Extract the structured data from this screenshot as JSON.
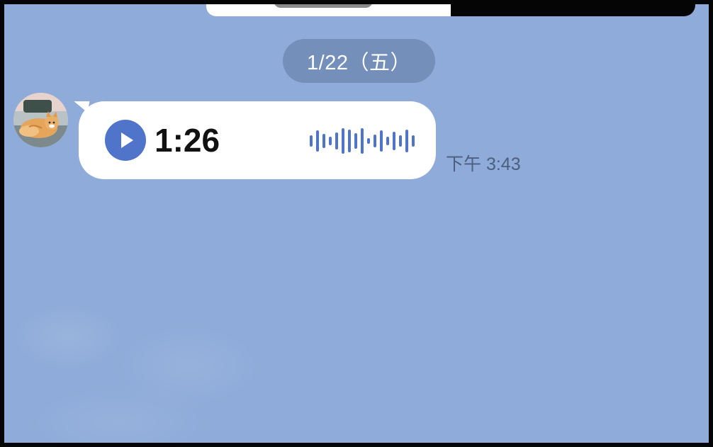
{
  "chat": {
    "date_separator": "1/22（五）",
    "message": {
      "type": "voice",
      "duration": "1:26",
      "timestamp": "下午 3:43",
      "play_icon": "play-icon",
      "waveform_icon": "waveform-icon",
      "avatar_icon": "cat-avatar"
    }
  },
  "colors": {
    "background": "#8eabd9",
    "bubble": "#ffffff",
    "accent": "#4f74c9",
    "date_pill": "#5f78a0",
    "timestamp": "#4c5f80"
  }
}
